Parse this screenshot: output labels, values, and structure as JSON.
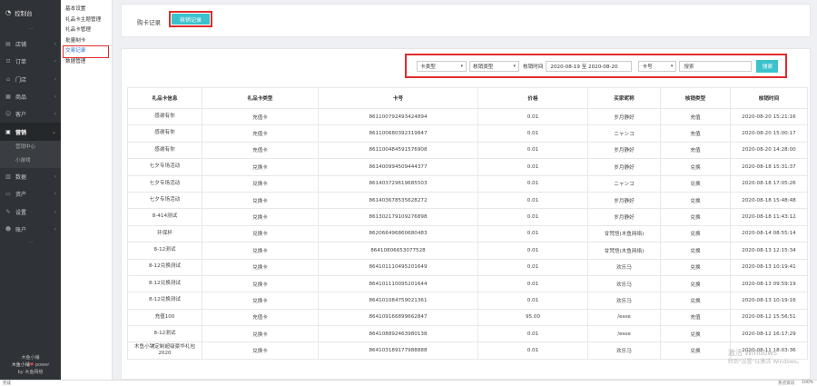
{
  "sidebar": {
    "header": "控制台",
    "items": [
      {
        "label": "店铺",
        "icon": "store-icon"
      },
      {
        "label": "订单",
        "icon": "cart-icon"
      },
      {
        "label": "门店",
        "icon": "shop-icon"
      },
      {
        "label": "商品",
        "icon": "goods-icon"
      },
      {
        "label": "客户",
        "icon": "user-icon"
      },
      {
        "label": "营销",
        "icon": "marketing-icon"
      }
    ],
    "sub_items": [
      "营销中心",
      "小游戏"
    ],
    "items_after": [
      {
        "label": "数据",
        "icon": "chart-icon"
      },
      {
        "label": "资产",
        "icon": "asset-icon"
      },
      {
        "label": "设置",
        "icon": "gear-icon"
      },
      {
        "label": "账户",
        "icon": "account-icon"
      }
    ],
    "footer_line1": "木鱼小铺",
    "footer_brand": "木鱼小铺",
    "footer_power": "power",
    "footer_by": "by 木鱼网络"
  },
  "submenu": {
    "items": [
      "基本设置",
      "礼品卡主题管理",
      "礼品卡管理",
      "批量制卡",
      "交易记录",
      "数据管理"
    ],
    "active_index": 4
  },
  "tabs": {
    "label": "购卡记录",
    "active": "核销记录"
  },
  "filters": {
    "card_type": "卡类型",
    "verify_type": "核销类型",
    "time_label": "核销时间",
    "date_range": "2020-08-19 至 2020-08-20",
    "field": "卡号",
    "search_placeholder": "搜索",
    "search_button": "搜索"
  },
  "table": {
    "headers": [
      "礼品卡信息",
      "礼品卡类型",
      "卡号",
      "价格",
      "买家昵称",
      "核销类型",
      "核销时间"
    ],
    "rows": [
      [
        "感谢有你",
        "充值卡",
        "861100792493424894",
        "0.01",
        "岁月静好",
        "充值",
        "2020-08-20 15:21:16"
      ],
      [
        "感谢有你",
        "充值卡",
        "861100680392319847",
        "0.01",
        "ニャンコ",
        "充值",
        "2020-08-20 15:00:17"
      ],
      [
        "感谢有你",
        "充值卡",
        "861100484591576908",
        "0.01",
        "岁月静好",
        "充值",
        "2020-08-20 14:28:00"
      ],
      [
        "七夕专场活动",
        "兑换卡",
        "861400994509444377",
        "0.01",
        "岁月静好",
        "兑换",
        "2020-08-18 15:31:37"
      ],
      [
        "七夕专场活动",
        "兑换卡",
        "861403729619685503",
        "0.01",
        "ニャンコ",
        "兑换",
        "2020-08-18 17:05:26"
      ],
      [
        "七夕专场活动",
        "兑换卡",
        "861403678535628272",
        "0.01",
        "岁月静好",
        "兑换",
        "2020-08-18 15:48:48"
      ],
      [
        "8-414测试",
        "兑换卡",
        "861302179109276898",
        "0.01",
        "岁月静好",
        "兑换",
        "2020-08-18 11:43:12"
      ],
      [
        "环保杯",
        "兑换卡",
        "862066496860680483",
        "0.01",
        "甘梵恺(木鱼网络)",
        "兑换",
        "2020-08-14 08:55:14"
      ],
      [
        "8-12测试",
        "兑换卡",
        "86410806653077528",
        "0.01",
        "甘梵恺(木鱼网络)",
        "兑换",
        "2020-08-13 12:15:34"
      ],
      [
        "8-12兑换测试",
        "兑换卡",
        "864101110495201649",
        "0.01",
        "欢乐马",
        "兑换",
        "2020-08-13 10:19:41"
      ],
      [
        "8-12兑换测试",
        "兑换卡",
        "864101110095201644",
        "0.01",
        "欢乐马",
        "兑换",
        "2020-08-13 09:59:19"
      ],
      [
        "8-12兑换测试",
        "兑换卡",
        "864101084759021361",
        "0.01",
        "欢乐马",
        "兑换",
        "2020-08-13 10:19:16"
      ],
      [
        "充值100",
        "充值卡",
        "864109166899662847",
        "95.00",
        "/esse",
        "充值",
        "2020-08-12 15:56:51"
      ],
      [
        "8-12测试",
        "兑换卡",
        "864108892463980138",
        "0.01",
        "/esse",
        "兑换",
        "2020-08-12 16:17:29"
      ],
      [
        "木鱼小铺定制超级豪华礼包2020",
        "兑换卡",
        "864103189177988888",
        "0.01",
        "欢乐马",
        "兑换",
        "2020-08-11 18:03:36"
      ]
    ]
  },
  "watermark": {
    "line1": "激活 Windows",
    "line2": "转到\"设置\"以激活 Windows。"
  },
  "statusbar": {
    "left": "完成",
    "right": [
      "热点资讯",
      "100%"
    ]
  }
}
